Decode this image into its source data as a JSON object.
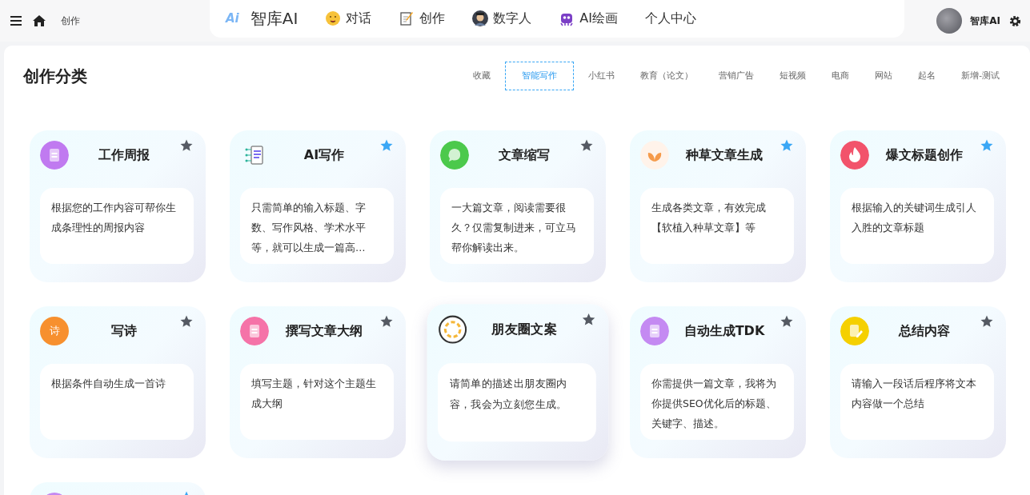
{
  "topbar": {
    "breadcrumb": "创作",
    "logo_mark": "Ai",
    "logo_text": "智库AI",
    "user_name": "智库AI"
  },
  "nav": [
    {
      "kind": "emoji",
      "label": "对话"
    },
    {
      "kind": "memo",
      "label": "创作"
    },
    {
      "kind": "person",
      "label": "数字人"
    },
    {
      "kind": "alien",
      "label": "AI绘画"
    },
    {
      "kind": "none",
      "label": "个人中心"
    }
  ],
  "page_title": "创作分类",
  "tabs": [
    {
      "label": "收藏",
      "selected": false
    },
    {
      "label": "智能写作",
      "selected": true
    },
    {
      "label": "小红书",
      "selected": false
    },
    {
      "label": "教育（论文）",
      "selected": false
    },
    {
      "label": "营销广告",
      "selected": false
    },
    {
      "label": "短视频",
      "selected": false
    },
    {
      "label": "电商",
      "selected": false
    },
    {
      "label": "网站",
      "selected": false
    },
    {
      "label": "起名",
      "selected": false
    },
    {
      "label": "新增-测试",
      "selected": false
    }
  ],
  "cards": [
    {
      "title": "工作周报",
      "description": "根据您的工作内容可帮你生成条理性的周报内容",
      "favorite": false,
      "highlighted": false,
      "kind": "doc",
      "color": "#c07af0"
    },
    {
      "title": "AI写作",
      "description": "只需简单的输入标题、字数、写作风格、学术水平等，就可以生成一篇高…",
      "favorite": true,
      "highlighted": false,
      "kind": "lines"
    },
    {
      "title": "文章缩写",
      "description": "一大篇文章，阅读需要很久？仅需复制进来，可立马帮你解读出来。",
      "favorite": false,
      "highlighted": false,
      "kind": "bubble",
      "color": "#4cc94c"
    },
    {
      "title": "种草文章生成",
      "description": "生成各类文章，有效完成【软植入种草文章】等",
      "favorite": true,
      "highlighted": false,
      "kind": "sprout"
    },
    {
      "title": "爆文标题创作",
      "description": "根据输入的关键词生成引人入胜的文章标题",
      "favorite": true,
      "highlighted": false,
      "kind": "flame",
      "color": "#f2536b"
    },
    {
      "title": "写诗",
      "description": "根据条件自动生成一首诗",
      "favorite": false,
      "highlighted": false,
      "kind": "glyph",
      "icon_text": "诗",
      "color": "#f7902e"
    },
    {
      "title": "撰写文章大纲",
      "description": "填写主题，针对这个主题生成大纲",
      "favorite": false,
      "highlighted": false,
      "kind": "doc",
      "color": "#f573a8"
    },
    {
      "title": "朋友圈文案",
      "description": "请简单的描述出朋友圈内容，我会为立刻您生成。",
      "favorite": false,
      "highlighted": true,
      "kind": "ring"
    },
    {
      "title": "自动生成TDK",
      "description": "你需提供一篇文章，我将为你提供SEO优化后的标题、关键字、描述。",
      "favorite": false,
      "highlighted": false,
      "kind": "doc",
      "color": "#c48af2"
    },
    {
      "title": "总结内容",
      "description": "请输入一段话后程序将文本内容做一个总结",
      "favorite": false,
      "highlighted": false,
      "kind": "pen",
      "color": "#f5d000"
    },
    {
      "favorite": true,
      "highlighted": false,
      "kind": "doc",
      "color": "#c48af2"
    }
  ]
}
